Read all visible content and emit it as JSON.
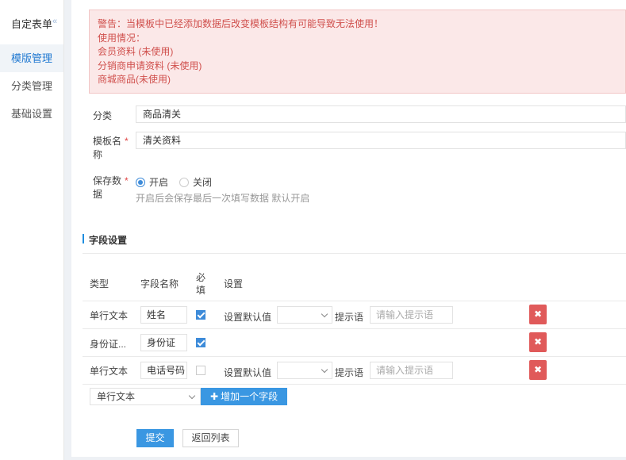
{
  "sidebar": {
    "title": "自定表单",
    "collapse_glyph": "«",
    "items": [
      {
        "label": "模版管理",
        "active": true
      },
      {
        "label": "分类管理",
        "active": false
      },
      {
        "label": "基础设置",
        "active": false
      }
    ]
  },
  "warning": {
    "lines": [
      "警告：当模板中已经添加数据后改变模板结构有可能导致无法使用！",
      "使用情况：",
      "会员资料 (未使用)",
      "分销商申请资料 (未使用)",
      "商城商品(未使用)"
    ]
  },
  "form": {
    "category": {
      "label": "分类",
      "value": "商品清关"
    },
    "template_name": {
      "label_line1": "模板名",
      "label_line2": "称",
      "required_mark": "*",
      "value": "清关资料"
    },
    "save_data": {
      "label_line1": "保存数",
      "label_line2": "据",
      "required_mark": "*",
      "option_on": "开启",
      "option_off": "关闭",
      "selected": "开启",
      "hint": "开启后会保存最后一次填写数据 默认开启"
    }
  },
  "fields_section": {
    "title": "字段设置",
    "headers": {
      "type": "类型",
      "field_name": "字段名称",
      "required_line1": "必",
      "required_line2": "填",
      "settings": "设置"
    },
    "rows": [
      {
        "type": "单行文本",
        "field_name": "姓名",
        "required": true,
        "default_label": "设置默认值",
        "prompt_label": "提示语",
        "prompt_placeholder": "请输入提示语"
      },
      {
        "type": "身份证...",
        "field_name": "身份证",
        "required": true
      },
      {
        "type": "单行文本",
        "field_name": "电话号码",
        "required": false,
        "default_label": "设置默认值",
        "prompt_label": "提示语",
        "prompt_placeholder": "请输入提示语"
      }
    ],
    "delete_glyph": "✖",
    "new_field_type": "单行文本",
    "add_button": {
      "icon": "plus-icon",
      "label": "增加一个字段"
    }
  },
  "actions": {
    "submit": "提交",
    "back": "返回列表"
  },
  "colors": {
    "accent": "#3a97e2",
    "danger": "#e05a5a",
    "warning_bg": "#fbe8e8",
    "warning_text": "#d0504d"
  }
}
